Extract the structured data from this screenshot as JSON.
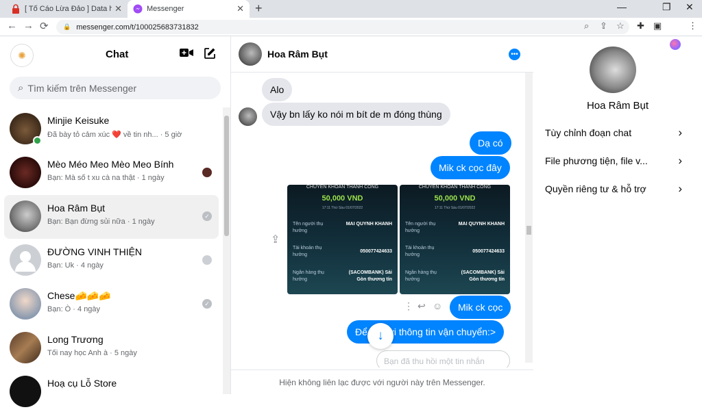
{
  "browser": {
    "tabs": [
      {
        "title": "[ Tố Cáo Lừa Đảo ] Data hệ thống"
      },
      {
        "title": "Messenger"
      }
    ],
    "url": "messenger.com/t/100025683731832",
    "new_tab": "+",
    "window_controls": {
      "minimize": "—",
      "maximize": "❐",
      "close": "✕"
    },
    "nav": {
      "back": "←",
      "forward": "→",
      "reload": "⟳"
    }
  },
  "sidebar": {
    "title": "Chat",
    "search_placeholder": "Tìm kiếm trên Messenger",
    "conversations": [
      {
        "name": "Minjie Keisuke",
        "preview": "Đã bày tỏ cảm xúc ❤️ về tin nh... · 5 giờ",
        "online": true
      },
      {
        "name": "Mèo Méo Meo Mèo Meo Bính",
        "preview": "Bạn: Mà số t xu cà na thật · 1 ngày"
      },
      {
        "name": "Hoa Râm Bụt",
        "preview": "Bạn: Bạn đừng sủi nữa · 1 ngày",
        "active": true
      },
      {
        "name": "ĐƯỜNG VINH THIỆN",
        "preview": "Bạn: Uk · 4 ngày"
      },
      {
        "name": "Chese🧀🧀🧀",
        "preview": "Bạn: Ò · 4 ngày"
      },
      {
        "name": "Long Trương",
        "preview": "Tối nay học Anh à · 5 ngày"
      },
      {
        "name": "Hoạ cụ Lỗ Store",
        "preview": ""
      }
    ]
  },
  "chat": {
    "contact_name": "Hoa Râm Bụt",
    "messages": {
      "m1": "Alo",
      "m2": "Vậy bn lấy ko nói m bít de m đóng thùng",
      "m3": "Dạ có",
      "m4": "Mik ck cọc đây",
      "m5": "Mik ck cọc",
      "m6": "Để … gửi thông tin vận chuyển:>",
      "m7": "Bạn đã thu hồi một tin nhắn"
    },
    "receipt": {
      "title": "CHUYỂN KHOẢN THÀNH CÔNG",
      "amount": "50,000 VND",
      "datetime": "17:11 Thứ Sáu 01/07/2022",
      "recipient_label": "Tên người thụ hưởng",
      "recipient": "MAI QUYNH KHANH",
      "account_label": "Tài khoản thụ hưởng",
      "account": "050077424633",
      "bank_label": "Ngân hàng thụ hưởng",
      "bank": "(SACOMBANK) Sài Gòn thương tín"
    },
    "footer_notice": "Hiện không liên lạc được với người này trên Messenger."
  },
  "info_panel": {
    "name": "Hoa Râm Bụt",
    "options": [
      "Tùy chỉnh đoạn chat",
      "File phương tiện, file v...",
      "Quyền riêng tư & hỗ trợ"
    ]
  },
  "colors": {
    "accent": "#0084ff",
    "bubble_in": "#e4e6eb",
    "online": "#31a24c"
  }
}
